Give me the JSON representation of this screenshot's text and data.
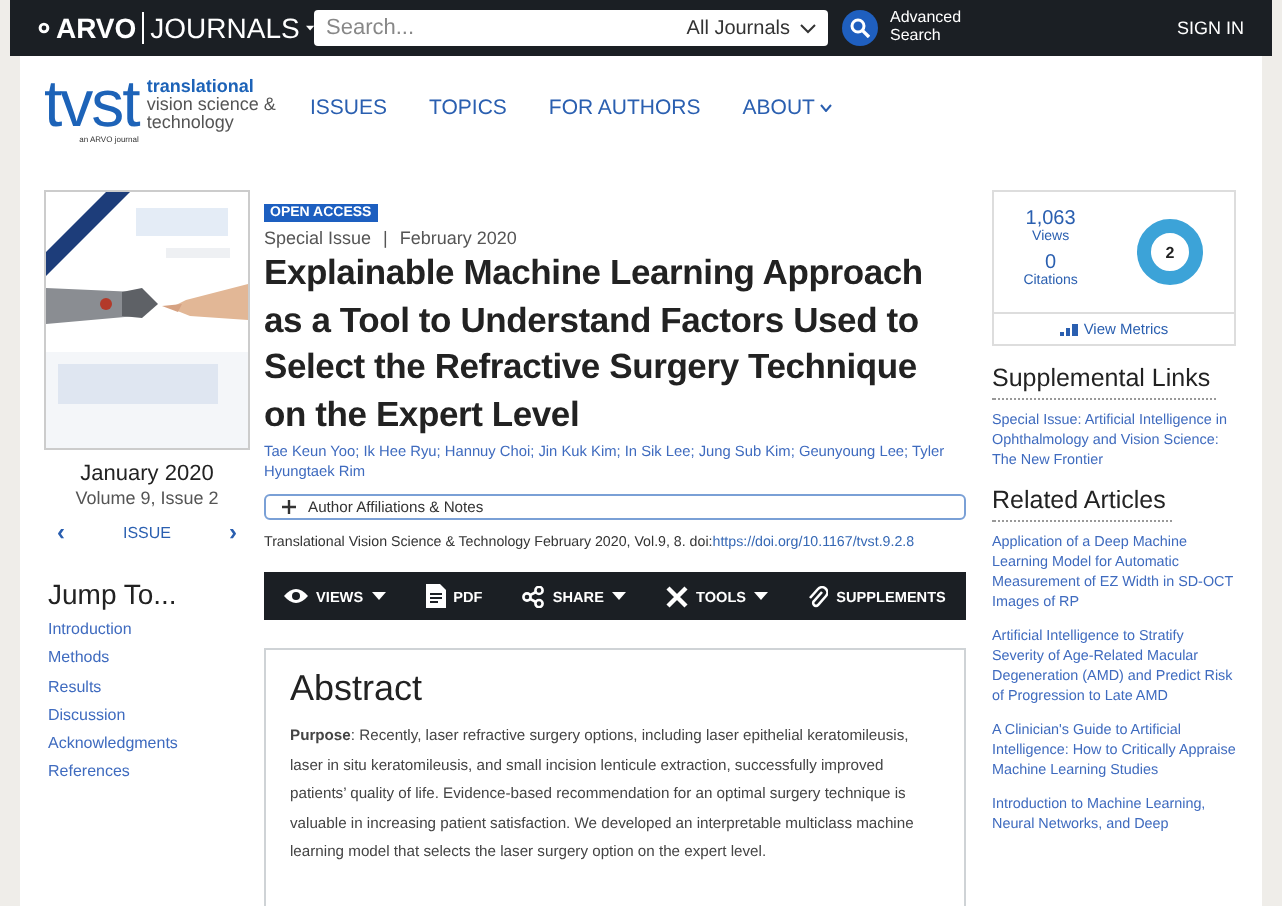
{
  "topbar": {
    "brand": "ARVO",
    "section": "JOURNALS",
    "search": {
      "placeholder": "Search...",
      "scope": "All Journals"
    },
    "advanced_search": "Advanced Search",
    "sign_in": "SIGN IN"
  },
  "header": {
    "logo": {
      "abbr": "tvst",
      "name": [
        "translational",
        "vision science &",
        "technology"
      ],
      "tagline": "an ARVO journal"
    },
    "nav": [
      {
        "label": "ISSUES",
        "dropdown": false
      },
      {
        "label": "TOPICS",
        "dropdown": false
      },
      {
        "label": "FOR AUTHORS",
        "dropdown": false
      },
      {
        "label": "ABOUT",
        "dropdown": true
      }
    ]
  },
  "issue": {
    "date": "January 2020",
    "volume": "Volume 9, Issue 2",
    "prev": "‹",
    "label": "ISSUE",
    "next": "›"
  },
  "jump_to": {
    "title": "Jump To...",
    "links": [
      "Introduction",
      "Methods",
      "Results",
      "Discussion",
      "Acknowledgments",
      "References"
    ]
  },
  "article": {
    "badge": "OPEN ACCESS",
    "category": "Special Issue",
    "separator": "|",
    "date": "February 2020",
    "title": "Explainable Machine Learning Approach as a Tool to Understand Factors Used to Select the Refractive Surgery Technique on the Expert Level",
    "authors": "Tae Keun Yoo; Ik Hee Ryu; Hannuy Choi; Jin Kuk Kim; In Sik Lee; Jung Sub Kim; Geunyoung Lee; Tyler Hyungtaek Rim",
    "affiliations": "Author Affiliations & Notes",
    "citation": "Translational Vision Science & Technology February 2020, Vol.9, 8. doi:",
    "doi": "https://doi.org/10.1167/tvst.9.2.8"
  },
  "toolbar": [
    {
      "kind": "views",
      "label": "VIEWS",
      "dropdown": true
    },
    {
      "kind": "pdf",
      "label": "PDF",
      "dropdown": false
    },
    {
      "kind": "share",
      "label": "SHARE",
      "dropdown": true
    },
    {
      "kind": "tools",
      "label": "TOOLS",
      "dropdown": true
    },
    {
      "kind": "supplements",
      "label": "SUPPLEMENTS",
      "dropdown": false
    }
  ],
  "abstract": {
    "heading": "Abstract",
    "text": "**Purpose**: Recently, laser refractive surgery options, including laser epithelial keratomileusis, laser in situ keratomileusis, and small incision lenticule extraction, successfully improved patients’ quality of life. Evidence-based recommendation for an optimal surgery technique is valuable in increasing patient satisfaction. We developed an interpretable multiclass machine learning model that selects the laser surgery option on the expert level."
  },
  "metrics": {
    "views": "1,063",
    "views_label": "Views",
    "citations": "0",
    "citations_label": "Citations",
    "score": "2",
    "view_metrics": "View Metrics"
  },
  "supplemental_links": {
    "title": "Supplemental Links",
    "links": [
      "Special Issue: Artificial Intelligence in Ophthalmology and Vision Science: The New Frontier"
    ]
  },
  "related_articles": {
    "title": "Related Articles",
    "links": [
      "Application of a Deep Machine Learning Model for Automatic Measurement of EZ Width in SD-OCT Images of RP",
      "Artificial Intelligence to Stratify Severity of Age-Related Macular Degeneration (AMD) and Predict Risk of Progression to Late AMD",
      "A Clinician's Guide to Artificial Intelligence: How to Critically Appraise Machine Learning Studies",
      "Introduction to Machine Learning, Neural Networks, and Deep"
    ]
  }
}
